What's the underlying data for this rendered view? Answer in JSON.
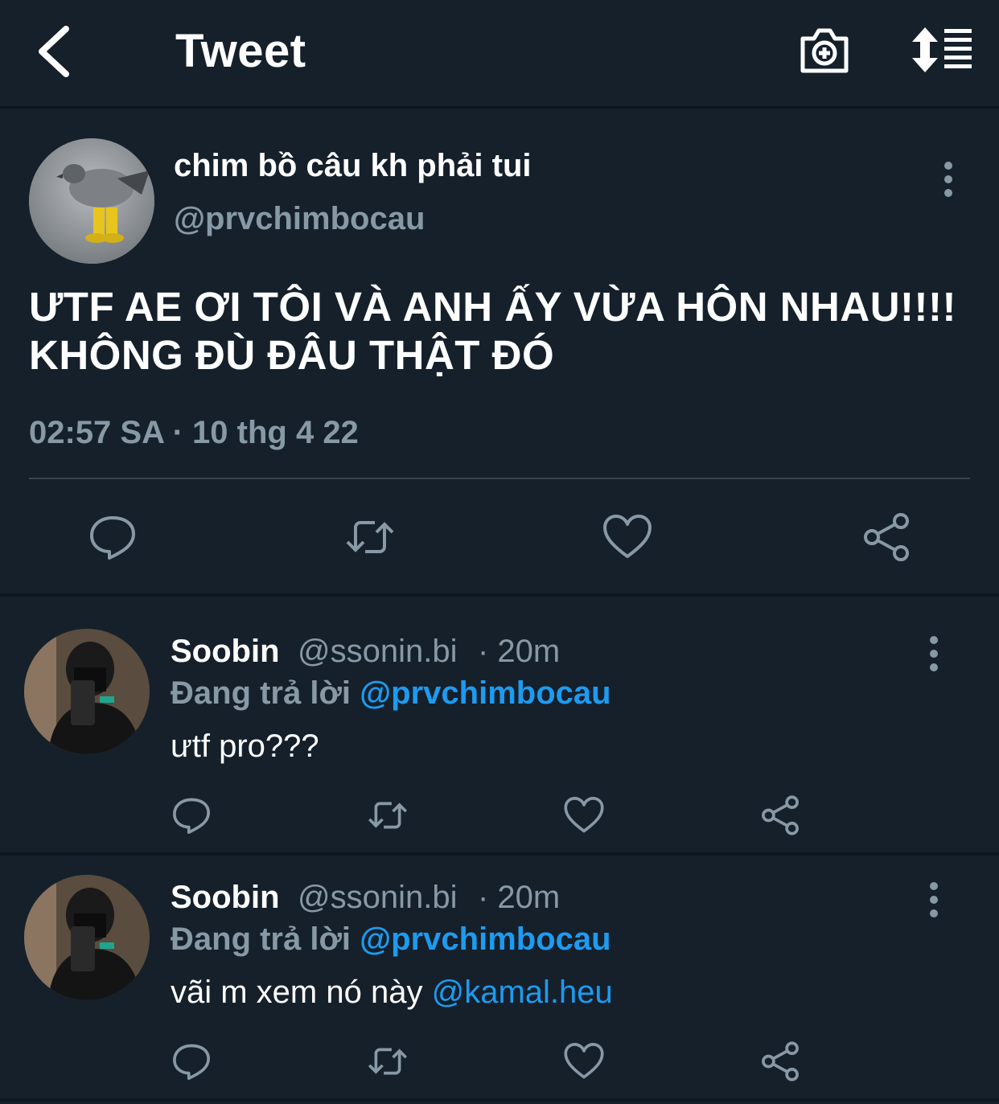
{
  "header": {
    "title": "Tweet",
    "icons": {
      "back": "chevron-left-icon",
      "camera": "camera-add-icon",
      "sort": "sort-lines-icon"
    }
  },
  "tweet": {
    "display_name": "chim bồ câu kh phải tui",
    "handle": "@prvchimbocau",
    "text": "ƯTF AE ƠI TÔI VÀ ANH ẤY VỪA HÔN NHAU!!!! KHÔNG ĐÙ ĐÂU THẬT ĐÓ",
    "meta": "02:57 SA · 10 thg 4 22",
    "actions": [
      "reply-icon",
      "retweet-icon",
      "like-icon",
      "share-icon"
    ]
  },
  "replies": [
    {
      "name": "Soobin",
      "handle": "@ssonin.bi",
      "time": "· 20m",
      "replying_label": "Đang trả lời",
      "replying_to": "@prvchimbocau",
      "text": "ưtf pro???",
      "mention": ""
    },
    {
      "name": "Soobin",
      "handle": "@ssonin.bi",
      "time": "· 20m",
      "replying_label": "Đang trả lời",
      "replying_to": "@prvchimbocau",
      "text": "vãi m xem nó này",
      "mention": "@kamal.heu"
    }
  ],
  "colors": {
    "background": "#15202b",
    "secondary_text": "#8899a6",
    "link": "#1d9bf0",
    "divider": "#38444d"
  }
}
